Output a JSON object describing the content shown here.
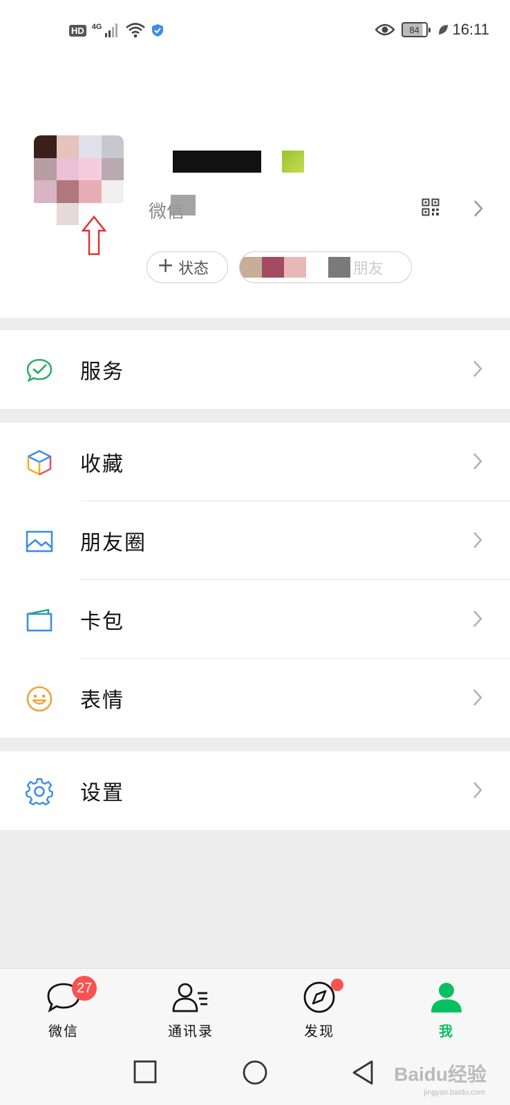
{
  "status_bar": {
    "hd": "HD",
    "network": "4G",
    "battery": "84",
    "time": "16:11"
  },
  "profile": {
    "wechat_id_label": "微信",
    "status_button": "状态",
    "friends_status_text": "朋友"
  },
  "menu": {
    "services": "服务",
    "favorites": "收藏",
    "moments": "朋友圈",
    "cards": "卡包",
    "stickers": "表情",
    "settings": "设置"
  },
  "tabbar": {
    "chats": "微信",
    "chats_badge": "27",
    "contacts": "通讯录",
    "discover": "发现",
    "me": "我"
  },
  "watermark": {
    "brand": "Baidu经验",
    "url": "jingyan.baidu.com"
  },
  "colors": {
    "accent": "#07c160",
    "badge": "#fa5151",
    "annotation_arrow": "#e0302f"
  }
}
